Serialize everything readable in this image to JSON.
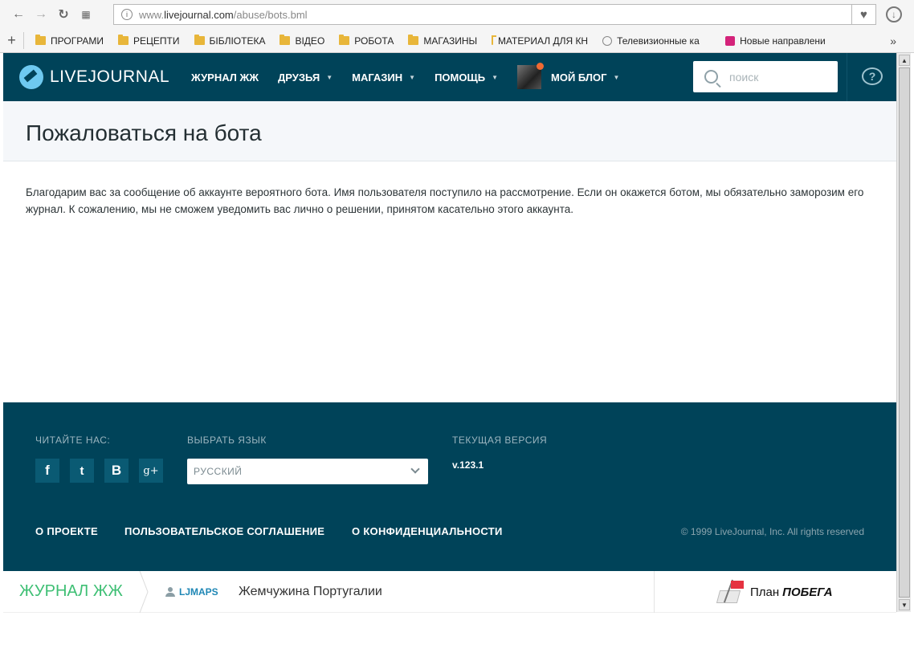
{
  "browser": {
    "url_prefix": "www.",
    "url_host": "livejournal.com",
    "url_path": "/abuse/bots.bml",
    "bookmarks": [
      {
        "label": "ПРОГРАМИ",
        "type": "folder"
      },
      {
        "label": "РЕЦЕПТИ",
        "type": "folder"
      },
      {
        "label": "БІБЛІОТЕКА",
        "type": "folder"
      },
      {
        "label": "ВІДЕО",
        "type": "folder"
      },
      {
        "label": "РОБОТА",
        "type": "folder"
      },
      {
        "label": "МАГАЗИНЫ",
        "type": "folder"
      },
      {
        "label": "МАТЕРИАЛ ДЛЯ КН",
        "type": "folder"
      },
      {
        "label": "Телевизионные ка",
        "type": "site"
      },
      {
        "label": "Новые направлени",
        "type": "site"
      }
    ],
    "more_label": "»"
  },
  "header": {
    "logo_text": "LIVEJOURNAL",
    "nav": {
      "journal": "ЖУРНАЛ ЖЖ",
      "friends": "ДРУЗЬЯ",
      "shop": "МАГАЗИН",
      "help": "ПОМОЩЬ",
      "my_blog": "МОЙ БЛОГ"
    },
    "search_placeholder": "поиск",
    "help_icon": "?"
  },
  "page": {
    "title": "Пожаловаться на бота",
    "body": "Благодарим вас за сообщение об аккаунте вероятного бота. Имя пользователя поступило на рассмотрение. Если он окажется ботом, мы обязательно заморозим его журнал. К сожалению, мы не сможем уведомить вас лично о решении, принятом касательно этого аккаунта."
  },
  "footer": {
    "read_us_label": "ЧИТАЙТЕ НАС:",
    "social": {
      "facebook": "f",
      "twitter": "t",
      "vk": "B",
      "gplus": "g+"
    },
    "language_label": "ВЫБРАТЬ ЯЗЫК",
    "language_value": "РУССКИЙ",
    "version_label": "ТЕКУЩАЯ ВЕРСИЯ",
    "version_value": "v.123.1",
    "links": {
      "about": "О ПРОЕКТЕ",
      "terms": "ПОЛЬЗОВАТЕЛЬСКОЕ СОГЛАШЕНИЕ",
      "privacy": "О КОНФИДЕНЦИАЛЬНОСТИ"
    },
    "copyright": "© 1999 LiveJournal, Inc. All rights reserved"
  },
  "bottom_bar": {
    "brand": "ЖУРНАЛ ЖЖ",
    "username": "LJMAPS",
    "post_title": "Жемчужина Португалии",
    "promo_plain": "План",
    "promo_bold": "ПОБЕГА"
  },
  "colors": {
    "header_bg": "#004359",
    "brand_green": "#3ebf74",
    "link_blue": "#1f87b5"
  }
}
